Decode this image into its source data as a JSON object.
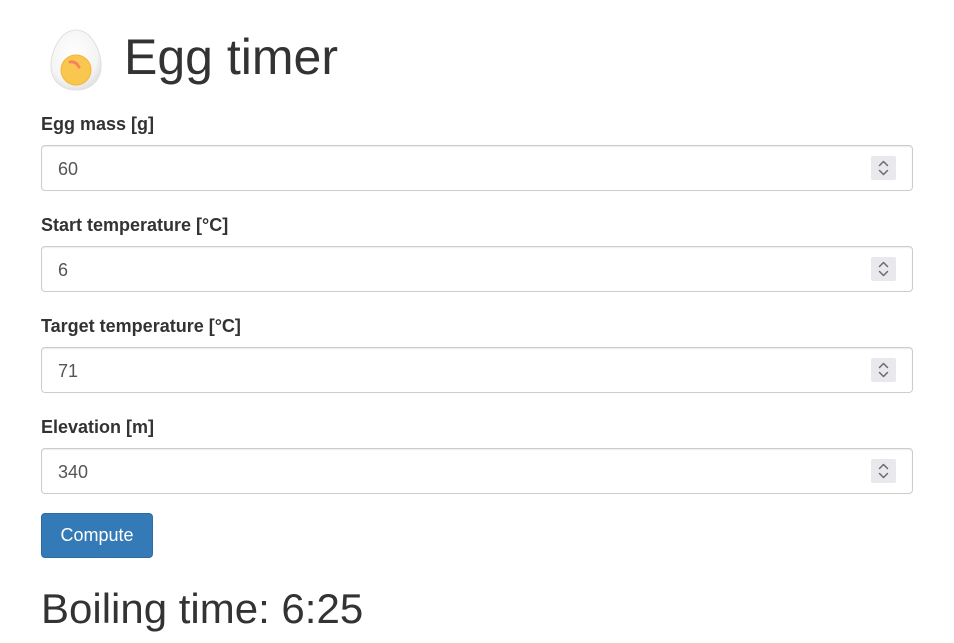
{
  "header": {
    "title": "Egg timer",
    "icon": "egg-icon"
  },
  "fields": [
    {
      "label": "Egg mass [g]",
      "value": "60"
    },
    {
      "label": "Start temperature [°C]",
      "value": "6"
    },
    {
      "label": "Target temperature [°C]",
      "value": "71"
    },
    {
      "label": "Elevation [m]",
      "value": "340"
    }
  ],
  "compute_button": {
    "label": "Compute"
  },
  "result": {
    "text": "Boiling time: 6:25"
  },
  "colors": {
    "primary": "#337ab7",
    "text": "#333333",
    "input_border": "#cccccc",
    "egg_white": "#f7f7f7",
    "egg_yolk": "#f9c74f",
    "egg_yolk_accent": "#f4845f"
  }
}
